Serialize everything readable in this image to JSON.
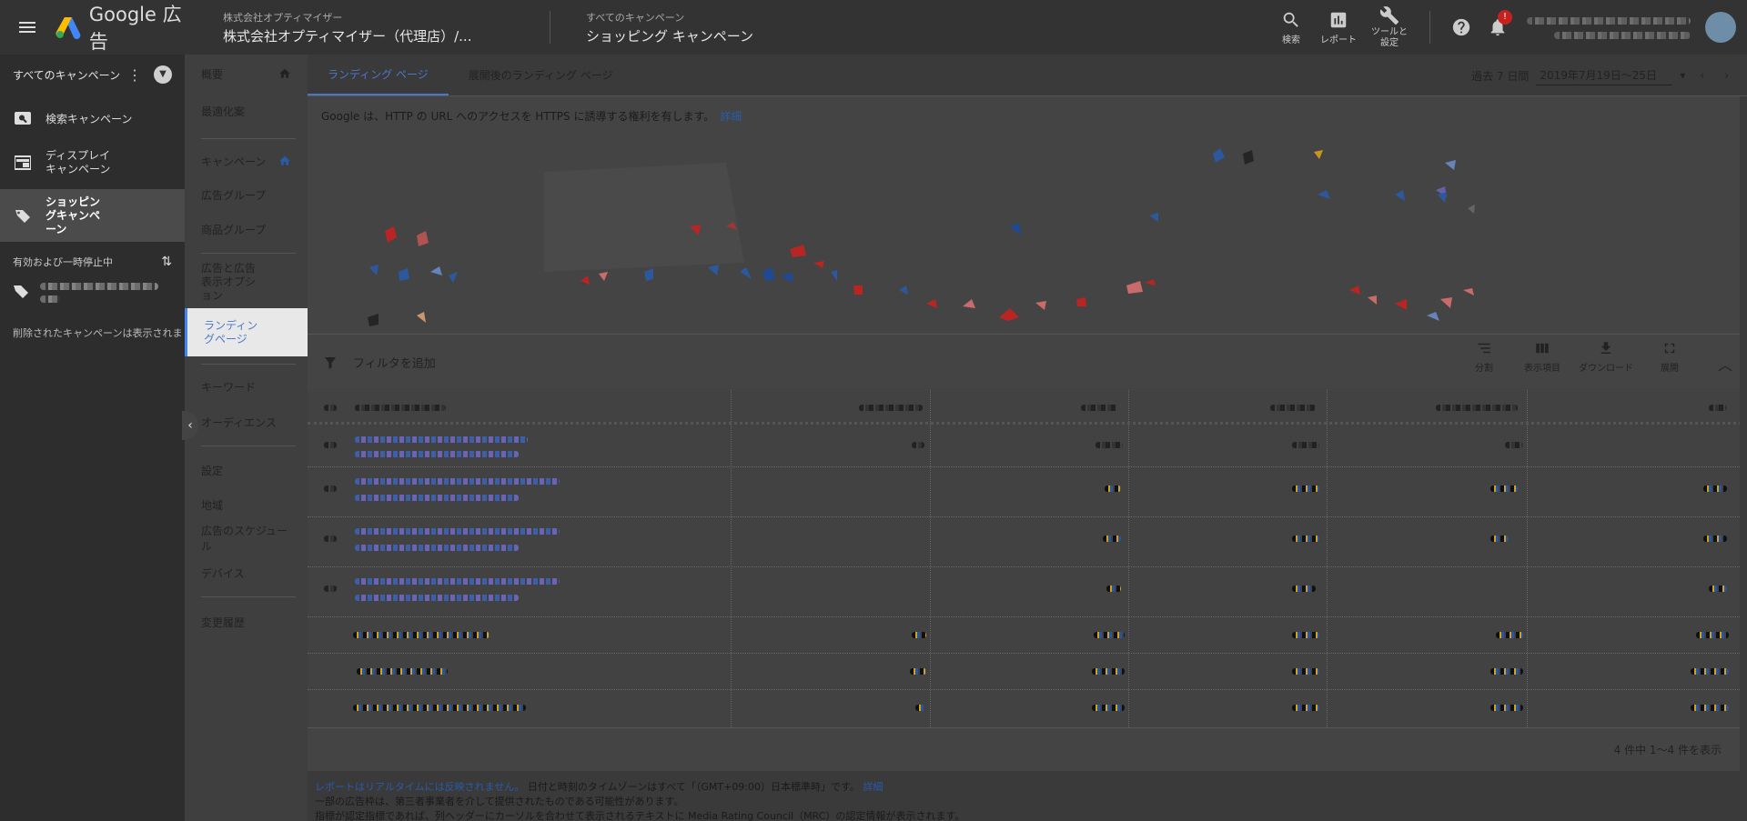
{
  "topbar": {
    "product_name": "Google 広告",
    "account_parent": "株式会社オプティマイザー",
    "account_name": "株式会社オプティマイザー（代理店）/...",
    "campaign_parent": "すべてのキャンペーン",
    "campaign_name": "ショッピング キャンペーン",
    "actions": [
      {
        "label": "検索",
        "icon": "search-icon"
      },
      {
        "label": "レポート",
        "icon": "report-icon"
      },
      {
        "label": "ツールと設定",
        "icon": "wrench-icon"
      }
    ],
    "notification_badge": "!"
  },
  "leftnav": {
    "header": "すべてのキャンペーン",
    "items": [
      {
        "label": "検索キャンペーン",
        "icon": "search-campaign-icon"
      },
      {
        "label": "ディスプレイキャンペーン",
        "icon": "display-campaign-icon"
      },
      {
        "label": "ショッピングキャンペーン",
        "icon": "shopping-tag-icon",
        "active": true
      }
    ],
    "section_label": "有効および一時停止中",
    "removed_note": "削除されたキャンペーンは表示されま"
  },
  "pagemenu": {
    "items": [
      {
        "label": "概要"
      },
      {
        "label": "最適化案"
      },
      {
        "label": "キャンペーン"
      },
      {
        "label": "広告グループ"
      },
      {
        "label": "商品グループ"
      },
      {
        "label": "広告と広告表示オプション"
      },
      {
        "label": "ランディングページ"
      },
      {
        "label": "キーワード"
      },
      {
        "label": "オーディエンス"
      },
      {
        "label": "設定"
      },
      {
        "label": "地域"
      },
      {
        "label": "広告のスケジュール"
      },
      {
        "label": "デバイス"
      },
      {
        "label": "変更履歴"
      }
    ]
  },
  "main": {
    "tabs": [
      {
        "label": "ランディング ページ",
        "active": true
      },
      {
        "label": "展開後のランディング ページ",
        "active": false
      }
    ],
    "date_prefix": "過去 7 日間",
    "date_range": "2019年7月19日～25日",
    "banner_text": "Google は、HTTP の URL へのアクセスを HTTPS に誘導する権利を有します。",
    "banner_link": "詳細",
    "filter_label": "フィルタを追加",
    "toolbar_actions": [
      {
        "label": "分割",
        "icon": "segment-icon"
      },
      {
        "label": "表示項目",
        "icon": "columns-icon"
      },
      {
        "label": "ダウンロード",
        "icon": "download-icon"
      },
      {
        "label": "展開",
        "icon": "expand-icon"
      }
    ],
    "table_footer": "4 件中 1～4 件を表示",
    "footnote_link": "レポートはリアルタイムには反映されません。",
    "footnote_line1": "日付と時刻のタイムゾーンはすべて「（GMT+09:00）日本標準時」です。",
    "footnote_link2": "詳細",
    "footnote_line2": "一部の広告枠は、第三者事業者を介して提供されたものである可能性があります。",
    "footnote_line3": "指標が認定指標であれば、列ヘッダーにカーソルを合わせて表示されるテキストに Media Rating Council（MRC）の認定情報が表示されます。"
  }
}
